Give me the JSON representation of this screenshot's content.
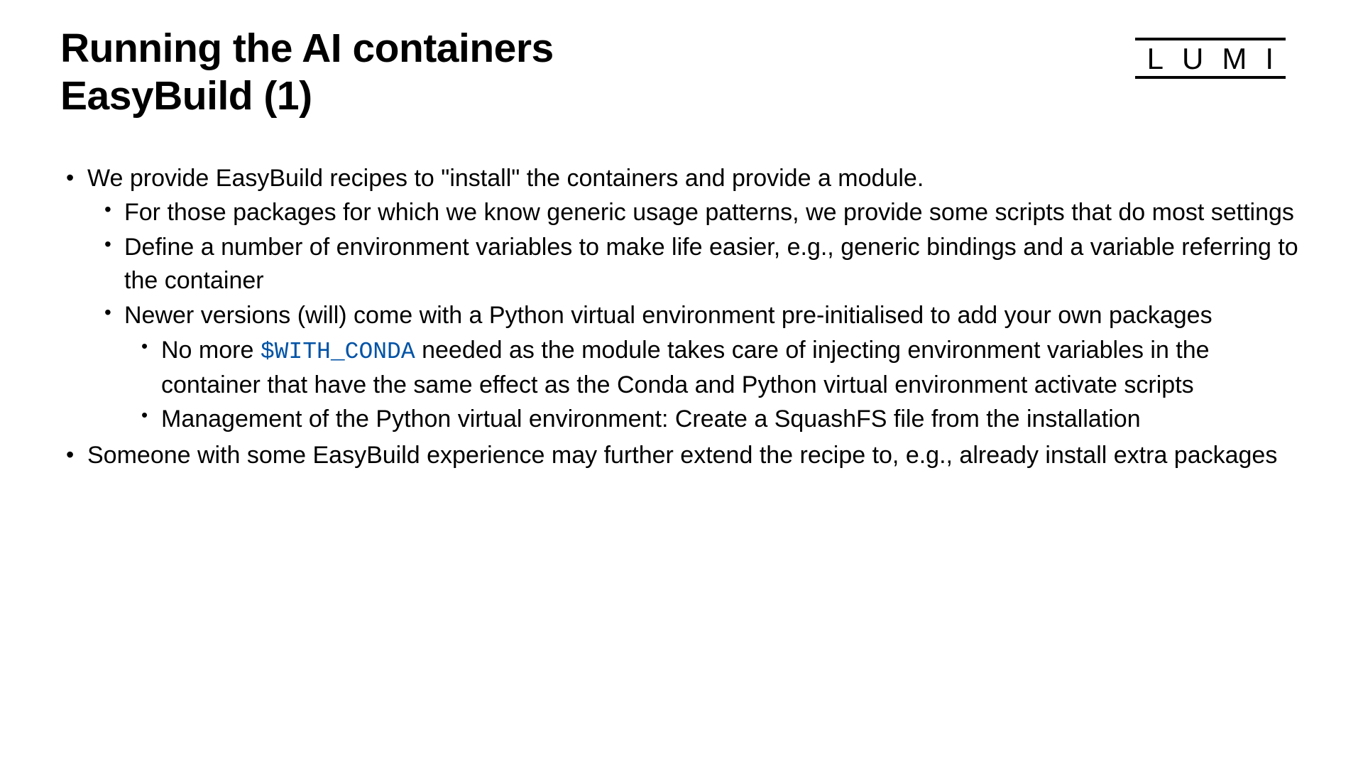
{
  "title": {
    "line1": "Running the AI containers",
    "line2": "EasyBuild (1)"
  },
  "logo": {
    "text": "LUMI"
  },
  "bullets": {
    "b1": "We provide EasyBuild recipes to \"install\" the containers and provide a module.",
    "b1_1": "For those packages for which we know generic usage patterns, we provide some scripts that do most settings",
    "b1_2": "Define a number of environment variables to make life easier, e.g., generic bindings and a variable referring to the container",
    "b1_3": "Newer versions (will) come with a Python virtual environment pre-initialised to add your own packages",
    "b1_3_1_prefix": "No more ",
    "b1_3_1_code": "$WITH_CONDA",
    "b1_3_1_suffix": " needed as the module takes care of injecting environment variables in the container that have the same effect as the Conda and Python virtual environment activate scripts",
    "b1_3_2": "Management of the Python virtual environment: Create a SquashFS file from the installation",
    "b2": "Someone with some EasyBuild experience may further extend the recipe to, e.g., already install extra packages"
  }
}
